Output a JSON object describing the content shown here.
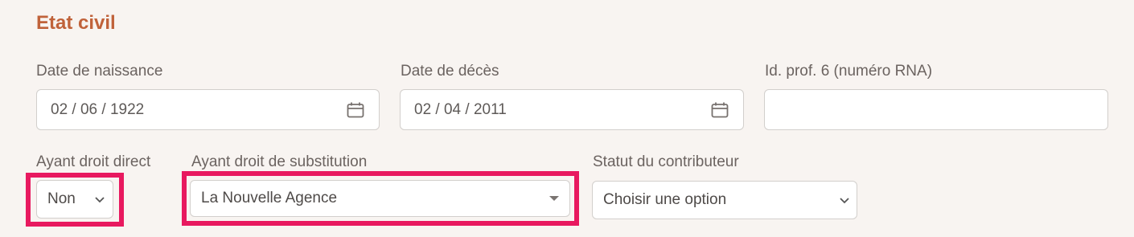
{
  "section": {
    "title": "Etat civil"
  },
  "fields": {
    "birth_date": {
      "label": "Date de naissance",
      "value": "02 / 06 / 1922"
    },
    "death_date": {
      "label": "Date de décès",
      "value": "02 / 04 / 2011"
    },
    "prof_id": {
      "label": "Id. prof. 6 (numéro RNA)",
      "value": ""
    },
    "direct_heir": {
      "label": "Ayant droit direct",
      "value": "Non"
    },
    "substitute_heir": {
      "label": "Ayant droit de substitution",
      "value": "La Nouvelle Agence"
    },
    "contributor_status": {
      "label": "Statut du contributeur",
      "value": "Choisir une option"
    }
  },
  "icons": {
    "calendar": "calendar-icon",
    "chevron": "chevron-down-icon",
    "caret": "caret-down-icon"
  },
  "colors": {
    "title": "#c0623a",
    "highlight": "#e8195f",
    "background": "#f8f4f1"
  }
}
